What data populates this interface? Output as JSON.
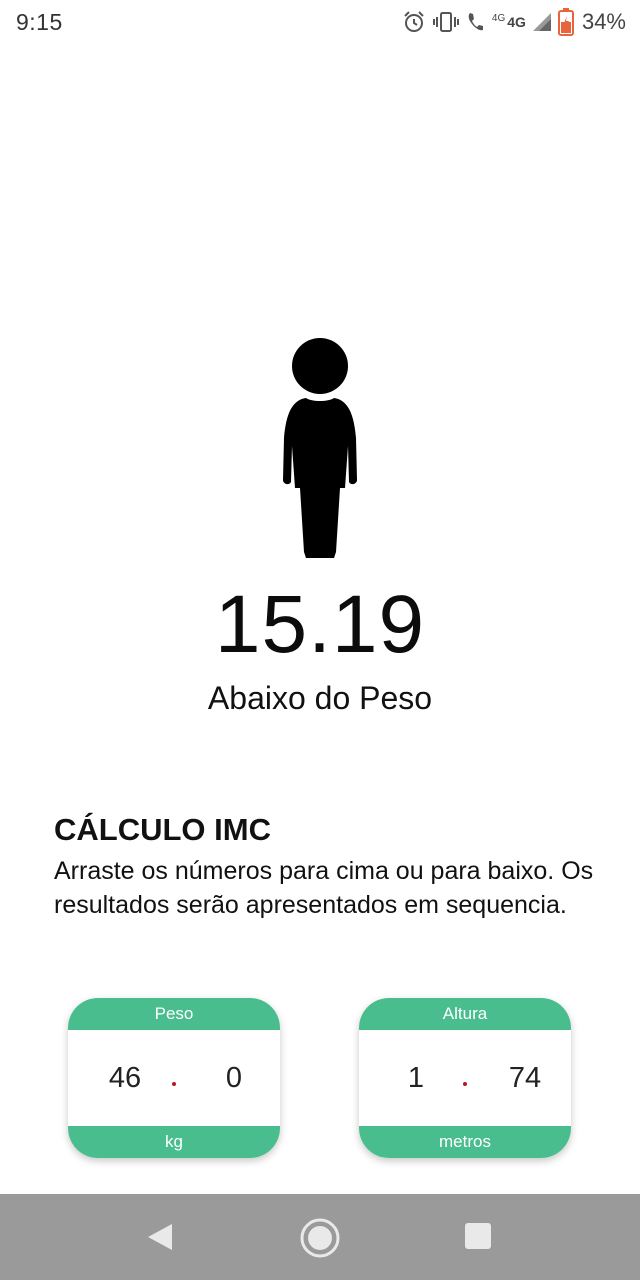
{
  "status_bar": {
    "time": "9:15",
    "network_small": "4G",
    "network_large": "4G",
    "battery_percent": "34%",
    "icons": [
      "alarm-icon",
      "vibrate-icon",
      "volte-call-icon",
      "signal-icon",
      "battery-icon"
    ],
    "battery_color": "#e8643c"
  },
  "result": {
    "figure_icon": "person-figure-icon",
    "bmi_value": "15.19",
    "category": "Abaixo do Peso"
  },
  "calculator": {
    "title": "CÁLCULO IMC",
    "instructions": "Arraste os números para cima ou para baixo. Os resultados serão apresentados em sequencia.",
    "weight": {
      "header": "Peso",
      "integer": "46",
      "decimal": "0",
      "unit": "kg"
    },
    "height": {
      "header": "Altura",
      "integer": "1",
      "decimal": "74",
      "unit": "metros"
    },
    "accent_color": "#49bd8e"
  },
  "nav_bar": {
    "icons": [
      "back-icon",
      "home-icon",
      "recent-apps-icon"
    ]
  }
}
